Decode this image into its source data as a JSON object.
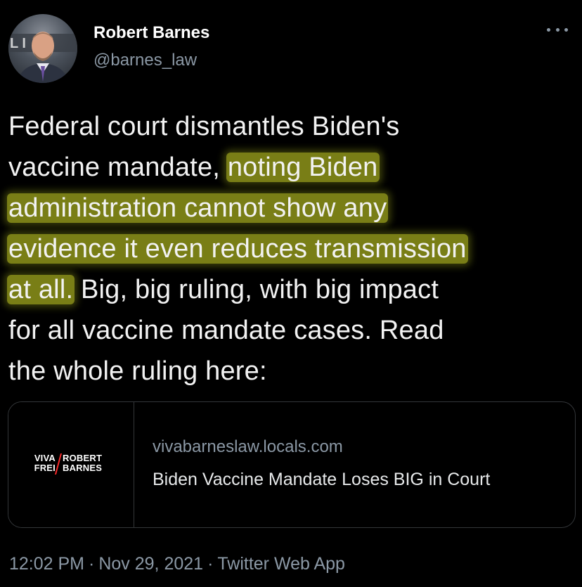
{
  "author": {
    "display_name": "Robert Barnes",
    "handle": "@barnes_law",
    "avatar_icon": "user-avatar"
  },
  "more_icon": "more-options-icon",
  "tweet": {
    "lines": [
      {
        "pre": "Federal court dismantles Biden's",
        "hl": "",
        "post": ""
      },
      {
        "pre": "vaccine mandate, ",
        "hl": "noting Biden",
        "post": ""
      },
      {
        "pre": "",
        "hl": "administration cannot show any",
        "post": ""
      },
      {
        "pre": "",
        "hl": "evidence it even reduces transmission",
        "post": ""
      },
      {
        "pre": "",
        "hl": "at all.",
        "post": " Big, big ruling, with big impact"
      },
      {
        "pre": "for all vaccine mandate cases. Read",
        "hl": "",
        "post": ""
      },
      {
        "pre": "the whole ruling here:",
        "hl": "",
        "post": ""
      }
    ],
    "highlight_color": "#c4cc24"
  },
  "card": {
    "logo": {
      "left_top": "VIVA",
      "left_bottom": "FREI",
      "right_top": "ROBERT",
      "right_bottom": "BARNES"
    },
    "domain": "vivabarneslaw.locals.com",
    "title": "Biden Vaccine Mandate Loses BIG in Court"
  },
  "meta": {
    "time": "12:02 PM",
    "date": "Nov 29, 2021",
    "separator": "·",
    "source": "Twitter Web App"
  },
  "colors": {
    "background": "#000000",
    "text": "#f2f2f2",
    "secondary": "#8b98a5",
    "border": "#333639"
  }
}
